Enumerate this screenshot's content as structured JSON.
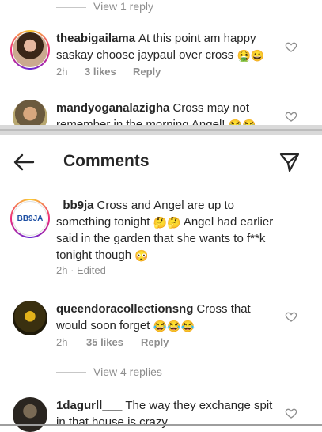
{
  "top_panel": {
    "view_replies_top": "View 1 reply",
    "comments": [
      {
        "username": "theabigailama",
        "text": "At this point  am happy saskay choose jaypaul over cross",
        "emojis": "🤮😀",
        "time": "2h",
        "likes": "3 likes",
        "reply": "Reply"
      },
      {
        "username": "mandyoganalazigha",
        "text": "Cross may not remember in the morning Angel!",
        "emojis": "😂😂"
      }
    ]
  },
  "header": {
    "back_icon": "arrow-left-icon",
    "title": "Comments",
    "share_icon": "paper-plane-icon"
  },
  "bottom_panel": {
    "comments": [
      {
        "username": "_bb9ja",
        "avatar_text": "BB9JA",
        "text_1": "Cross and Angel are up to something tonight",
        "emojis_1": "🤔🤔",
        "text_2": "Angel had earlier said in the garden that she wants to f**k tonight though",
        "emojis_2": "😳",
        "time": "2h · Edited"
      },
      {
        "username": "queendoracollectionsng",
        "text": "Cross that would soon forget",
        "emojis": "😂😂😂",
        "time": "2h",
        "likes": "35 likes",
        "reply": "Reply"
      },
      {
        "username": "1dagurll___",
        "text": "The way they exchange spit in that house is crazy"
      }
    ],
    "view_replies": "View 4 replies"
  },
  "colors": {
    "text": "#262626",
    "secondary": "#8e8e8e",
    "divider": "#d9d9d9"
  }
}
